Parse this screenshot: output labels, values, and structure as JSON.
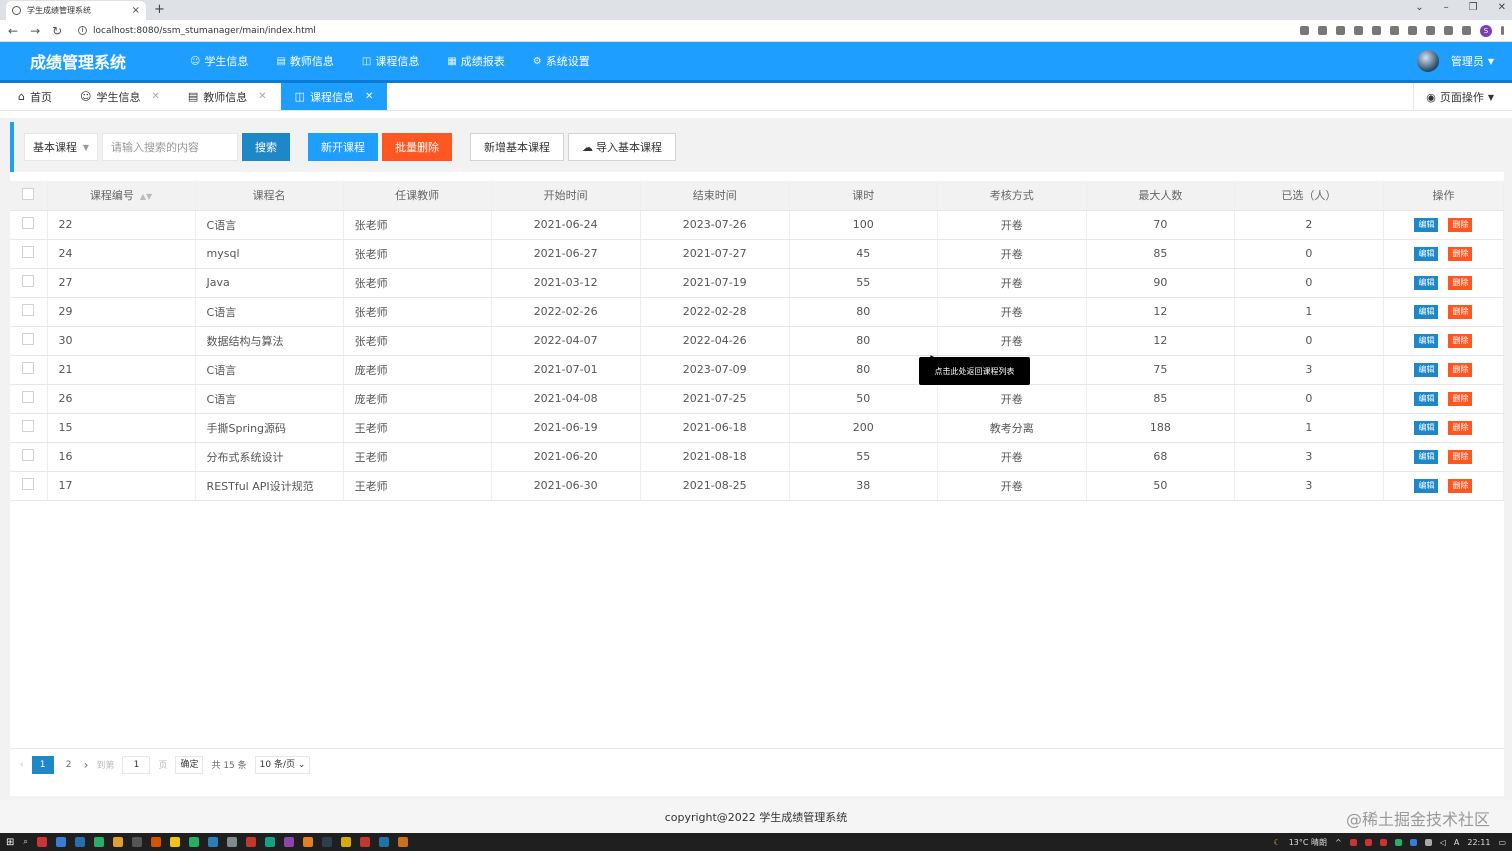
{
  "browser": {
    "tab_title": "学生成绩管理系统",
    "url": "localhost:8080/ssm_stumanager/main/index.html",
    "profile_initial": "S"
  },
  "app": {
    "title": "成绩管理系统",
    "nav": [
      {
        "label": "学生信息",
        "icon": "users-icon"
      },
      {
        "label": "教师信息",
        "icon": "document-icon"
      },
      {
        "label": "课程信息",
        "icon": "book-icon"
      },
      {
        "label": "成绩报表",
        "icon": "table-icon"
      },
      {
        "label": "系统设置",
        "icon": "gear-icon"
      }
    ],
    "user": "管理员"
  },
  "tabs": {
    "home": "首页",
    "items": [
      "学生信息",
      "教师信息",
      "课程信息"
    ],
    "active": "课程信息",
    "page_ops": "页面操作"
  },
  "toolbar": {
    "type_select": "基本课程",
    "search_placeholder": "请输入搜索的内容",
    "search": "搜索",
    "new_course": "新开课程",
    "batch_delete": "批量删除",
    "add_basic": "新增基本课程",
    "import_basic": "导入基本课程"
  },
  "table": {
    "headers": [
      "课程编号",
      "课程名",
      "任课教师",
      "开始时间",
      "结束时间",
      "课时",
      "考核方式",
      "最大人数",
      "已选（人）",
      "操作"
    ],
    "edit_label": "编辑",
    "delete_label": "删除",
    "rows": [
      [
        "22",
        "C语言",
        "张老师",
        "2021-06-24",
        "2023-07-26",
        "100",
        "开卷",
        "70",
        "2"
      ],
      [
        "24",
        "mysql",
        "张老师",
        "2021-06-27",
        "2021-07-27",
        "45",
        "开卷",
        "85",
        "0"
      ],
      [
        "27",
        "Java",
        "张老师",
        "2021-03-12",
        "2021-07-19",
        "55",
        "开卷",
        "90",
        "0"
      ],
      [
        "29",
        "C语言",
        "张老师",
        "2022-02-26",
        "2022-02-28",
        "80",
        "开卷",
        "12",
        "1"
      ],
      [
        "30",
        "数据结构与算法",
        "张老师",
        "2022-04-07",
        "2022-04-26",
        "80",
        "开卷",
        "12",
        "0"
      ],
      [
        "21",
        "C语言",
        "庞老师",
        "2021-07-01",
        "2023-07-09",
        "80",
        "",
        "75",
        "3"
      ],
      [
        "26",
        "C语言",
        "庞老师",
        "2021-04-08",
        "2021-07-25",
        "50",
        "开卷",
        "85",
        "0"
      ],
      [
        "15",
        "手撕Spring源码",
        "王老师",
        "2021-06-19",
        "2021-06-18",
        "200",
        "教考分离",
        "188",
        "1"
      ],
      [
        "16",
        "分布式系统设计",
        "王老师",
        "2021-06-20",
        "2021-08-18",
        "55",
        "开卷",
        "68",
        "3"
      ],
      [
        "17",
        "RESTful API设计规范",
        "王老师",
        "2021-06-30",
        "2021-08-25",
        "38",
        "开卷",
        "50",
        "3"
      ]
    ]
  },
  "tooltip": "点击此处返回课程列表",
  "pager": {
    "current": "1",
    "next_page": "2",
    "goto": "到第",
    "page_input": "1",
    "page_unit": "页",
    "confirm": "确定",
    "total": "共 15 条",
    "size": "10 条/页"
  },
  "footer": "copyright@2022 学生成绩管理系统",
  "watermark": "@稀土掘金技术社区",
  "taskbar": {
    "weather": "13°C 晴朗",
    "time": "22:11"
  }
}
